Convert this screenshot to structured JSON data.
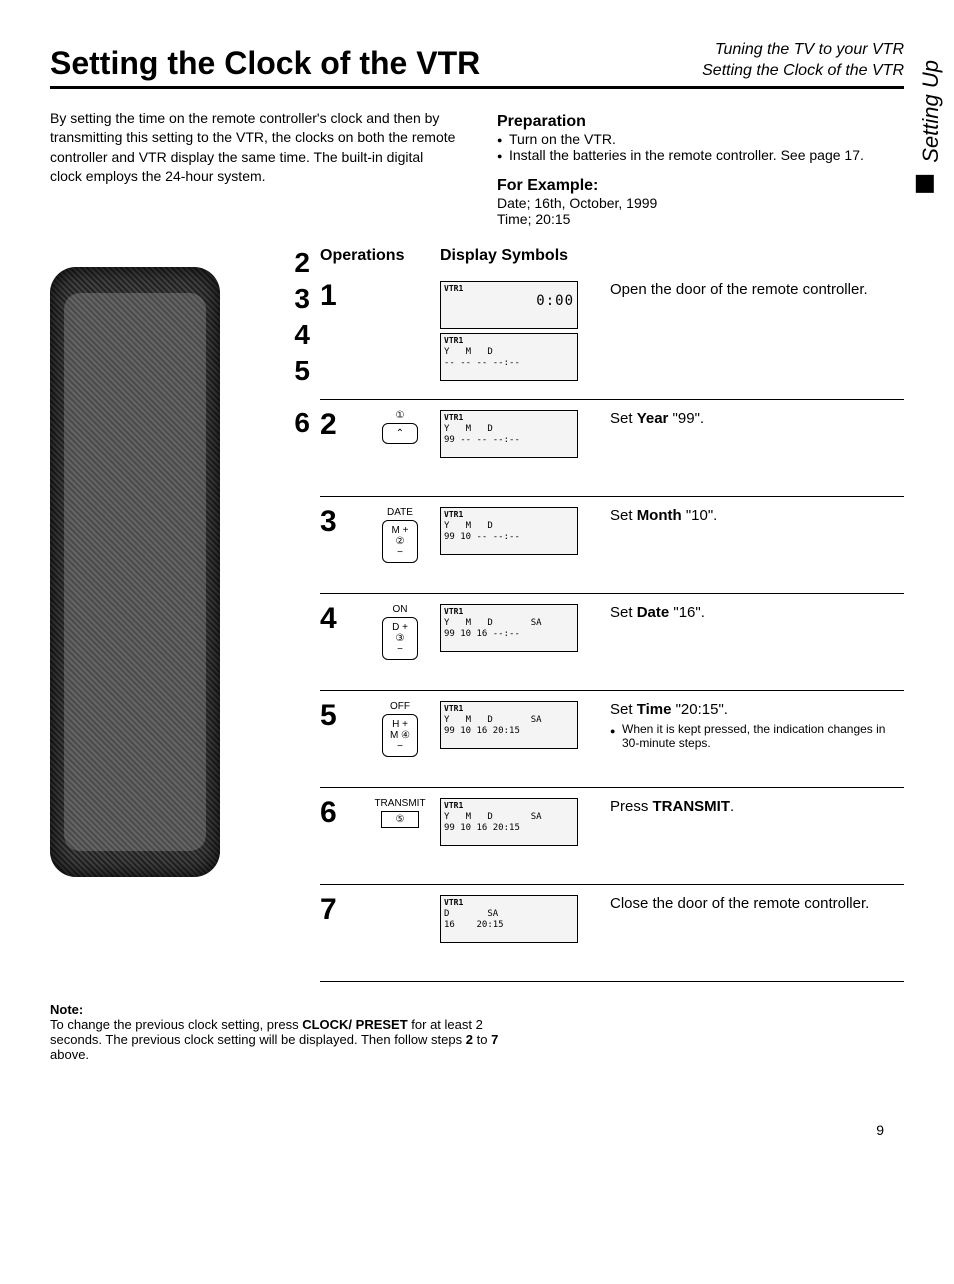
{
  "side_tab": "Setting Up",
  "header": {
    "title": "Setting the Clock of the VTR",
    "crumb1": "Tuning the TV to your VTR",
    "crumb2": "Setting the Clock of the VTR"
  },
  "intro": "By setting the time on the remote controller's clock and then by transmitting this setting to the VTR, the clocks on both the remote controller and VTR display the same time. The built-in digital clock employs the 24-hour system.",
  "preparation": {
    "heading": "Preparation",
    "item1": "Turn on the VTR.",
    "item2": "Install the batteries in the remote controller.  See page 17."
  },
  "example": {
    "heading": "For Example:",
    "line1": "Date;   16th, October, 1999",
    "line2": "Time;   20:15"
  },
  "ops_heading": "Operations",
  "display_heading": "Display Symbols",
  "callouts": {
    "a": "2",
    "b": "3",
    "c": "4",
    "d": "5",
    "e": "6"
  },
  "steps": [
    {
      "num": "1",
      "op_label": "",
      "displays": [
        {
          "tag": "VTR1",
          "big": "0:00",
          "line2": ""
        },
        {
          "tag": "VTR1",
          "big": "",
          "line2": "Y   M   D\n-- -- -- --:--"
        }
      ],
      "desc": "Open the door of the remote controller."
    },
    {
      "num": "2",
      "op_label": "①",
      "op_top": "⌃",
      "op_bot": "⌄",
      "displays": [
        {
          "tag": "VTR1",
          "big": "",
          "line2": "Y   M   D\n99 -- -- --:--"
        }
      ],
      "desc_pre": "Set ",
      "desc_bold": "Year",
      "desc_post": " \"99\"."
    },
    {
      "num": "3",
      "op_label": "DATE",
      "op_sub": "M +\n②\n−",
      "displays": [
        {
          "tag": "VTR1",
          "big": "",
          "line2": "Y   M   D\n99 10 -- --:--"
        }
      ],
      "desc_pre": "Set ",
      "desc_bold": "Month",
      "desc_post": " \"10\"."
    },
    {
      "num": "4",
      "op_label": "ON",
      "op_sub": "D +\n③\n−",
      "displays": [
        {
          "tag": "VTR1",
          "big": "",
          "line2": "Y   M   D       SA\n99 10 16 --:--"
        }
      ],
      "desc_pre": "Set ",
      "desc_bold": "Date",
      "desc_post": " \"16\"."
    },
    {
      "num": "5",
      "op_label": "OFF",
      "op_sub": "H +\nM ④\n−",
      "displays": [
        {
          "tag": "VTR1",
          "big": "",
          "line2": "Y   M   D       SA\n99 10 16 20:15"
        }
      ],
      "desc_pre": "Set ",
      "desc_bold": "Time",
      "desc_post": " \"20:15\".",
      "note": "When it is kept pressed, the indication changes in 30-minute steps."
    },
    {
      "num": "6",
      "op_label": "TRANSMIT",
      "op_sub": "⑤",
      "tri": true,
      "displays": [
        {
          "tag": "VTR1",
          "big": "",
          "line2": "Y   M   D       SA\n99 10 16 20:15"
        }
      ],
      "desc_pre": "Press ",
      "desc_bold": "TRANSMIT",
      "desc_post": "."
    },
    {
      "num": "7",
      "op_label": "",
      "displays": [
        {
          "tag": "VTR1",
          "big": "",
          "line2": "D       SA\n16    20:15"
        }
      ],
      "desc": "Close the door of the remote controller."
    }
  ],
  "note": {
    "heading": "Note:",
    "body_pre": "To change the previous clock setting, press ",
    "body_bold": "CLOCK/ PRESET",
    "body_post": " for at least 2 seconds. The previous clock setting will be displayed. Then follow steps ",
    "body_bold2": "2",
    "body_mid": " to ",
    "body_bold3": "7",
    "body_end": " above."
  },
  "page_number": "9"
}
